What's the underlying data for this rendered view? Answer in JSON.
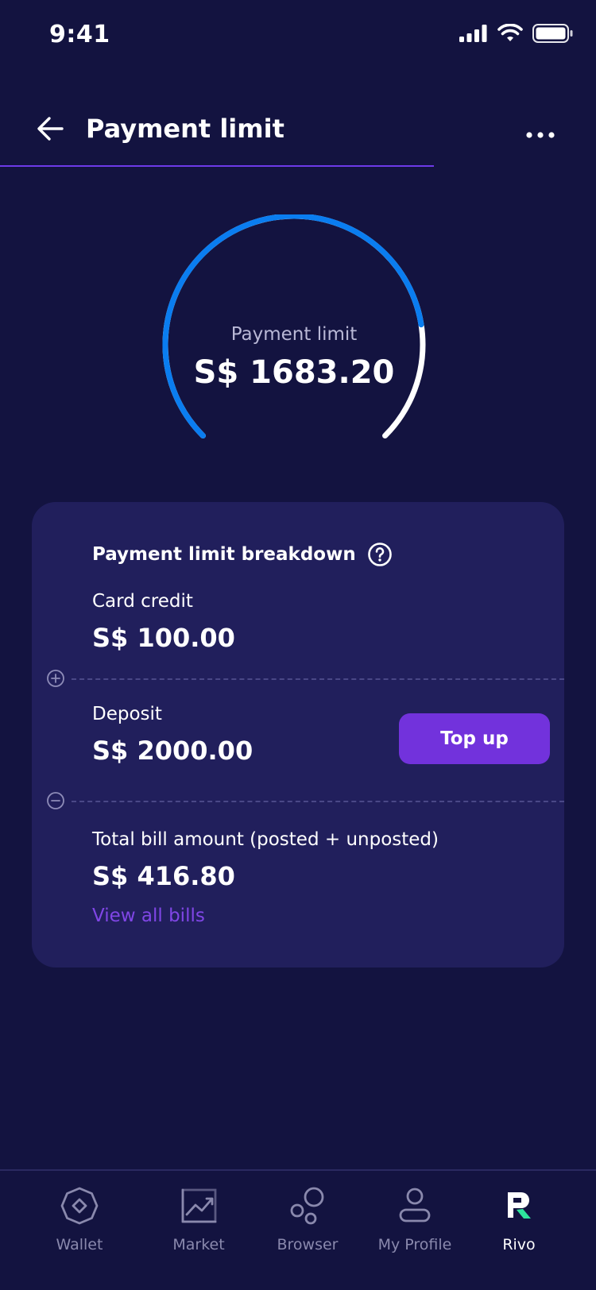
{
  "status_bar": {
    "time": "9:41"
  },
  "header": {
    "title": "Payment limit"
  },
  "gauge": {
    "label": "Payment limit",
    "value": "S$ 1683.20",
    "fill_fraction": 0.8
  },
  "breakdown": {
    "title": "Payment limit breakdown",
    "card_credit_label": "Card credit",
    "card_credit_amount": "S$ 100.00",
    "deposit_label": "Deposit",
    "deposit_amount": "S$ 2000.00",
    "topup_label": "Top up",
    "total_bill_label": "Total bill amount (posted + unposted)",
    "total_bill_amount": "S$ 416.80",
    "view_bills_label": "View all bills"
  },
  "tabs": [
    {
      "label": "Wallet",
      "icon": "wallet-icon"
    },
    {
      "label": "Market",
      "icon": "market-icon"
    },
    {
      "label": "Browser",
      "icon": "browser-icon"
    },
    {
      "label": "My Profile",
      "icon": "profile-icon"
    },
    {
      "label": "Rivo",
      "icon": "rivo-logo-icon",
      "active": true
    }
  ],
  "colors": {
    "background": "#131340",
    "card": "#211f5c",
    "accent": "#7232dc",
    "gauge_blue": "#0a7df0",
    "link": "#8046e6"
  }
}
